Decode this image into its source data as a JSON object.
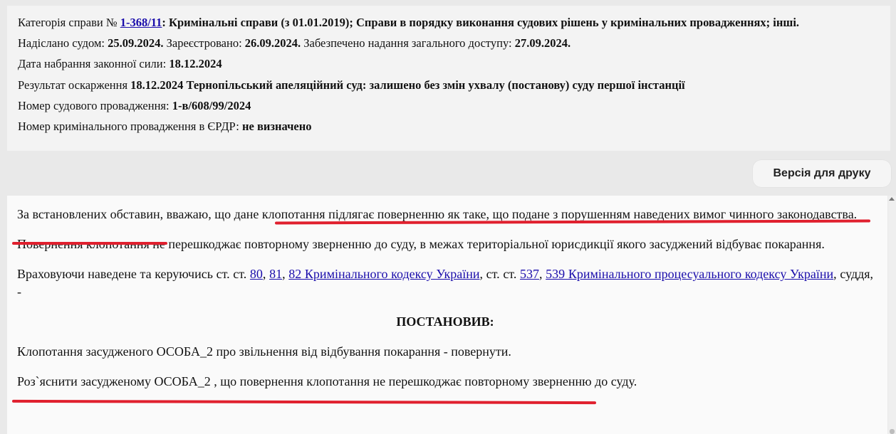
{
  "meta": {
    "category_prefix": "Категорія справи № ",
    "case_number": "1-368/11",
    "category_text": ": Кримінальні справи (з 01.01.2019); Справи в порядку виконання судових рішень у кримінальних провадженнях; інші.",
    "sent_label": "Надіслано судом: ",
    "sent_value": "25.09.2024.",
    "registered_label": " Зареєстровано: ",
    "registered_value": "26.09.2024.",
    "access_label": " Забезпечено надання загального доступу: ",
    "access_value": "27.09.2024.",
    "effective_label": "Дата набрання законної сили: ",
    "effective_value": "18.12.2024",
    "appeal_label": "Результат оскарження ",
    "appeal_value": "18.12.2024 Тернопільський апеляційний суд: залишено без змін ухвалу (постанову) суду першої інстанції",
    "proceeding_label": "Номер судового провадження: ",
    "proceeding_value": "1-в/608/99/2024",
    "erdr_label": "Номер кримінального провадження в ЄРДР: ",
    "erdr_value": "не визначено"
  },
  "print_button": "Версія для друку",
  "document": {
    "p1_start": "За встановлених обставин, вважаю, що ",
    "p1_marked": "дане клопотання підлягає поверненню як таке, що подане з порушенням наведених вимог чинного законодавства.",
    "p2": "Повернення клопотання не перешкоджає повторному зверненню до суду, в межах територіальної юрисдикції якого засуджений відбуває покарання.",
    "p3_start": "Враховуючи наведене та керуючись ст. ст. ",
    "link_80": "80",
    "sep1": ", ",
    "link_81": "81",
    "sep2": ", ",
    "link_82": "82 Кримінального кодексу України",
    "p3_mid": ", ст. ст. ",
    "link_537": "537",
    "sep3": ", ",
    "link_539": "539 Кримінального процесуального кодексу України",
    "p3_end": ", суддя, -",
    "heading": "ПОСТАНОВИВ:",
    "p4": "Клопотання засудженого ОСОБА_2 про звільнення від відбування покарання - повернути.",
    "p5": "Роз`яснити засудженому ОСОБА_2 , що повернення клопотання не перешкоджає повторному зверненню до суду."
  },
  "colors": {
    "highlight_underline": "#e0202e",
    "link": "#1a0dab"
  }
}
